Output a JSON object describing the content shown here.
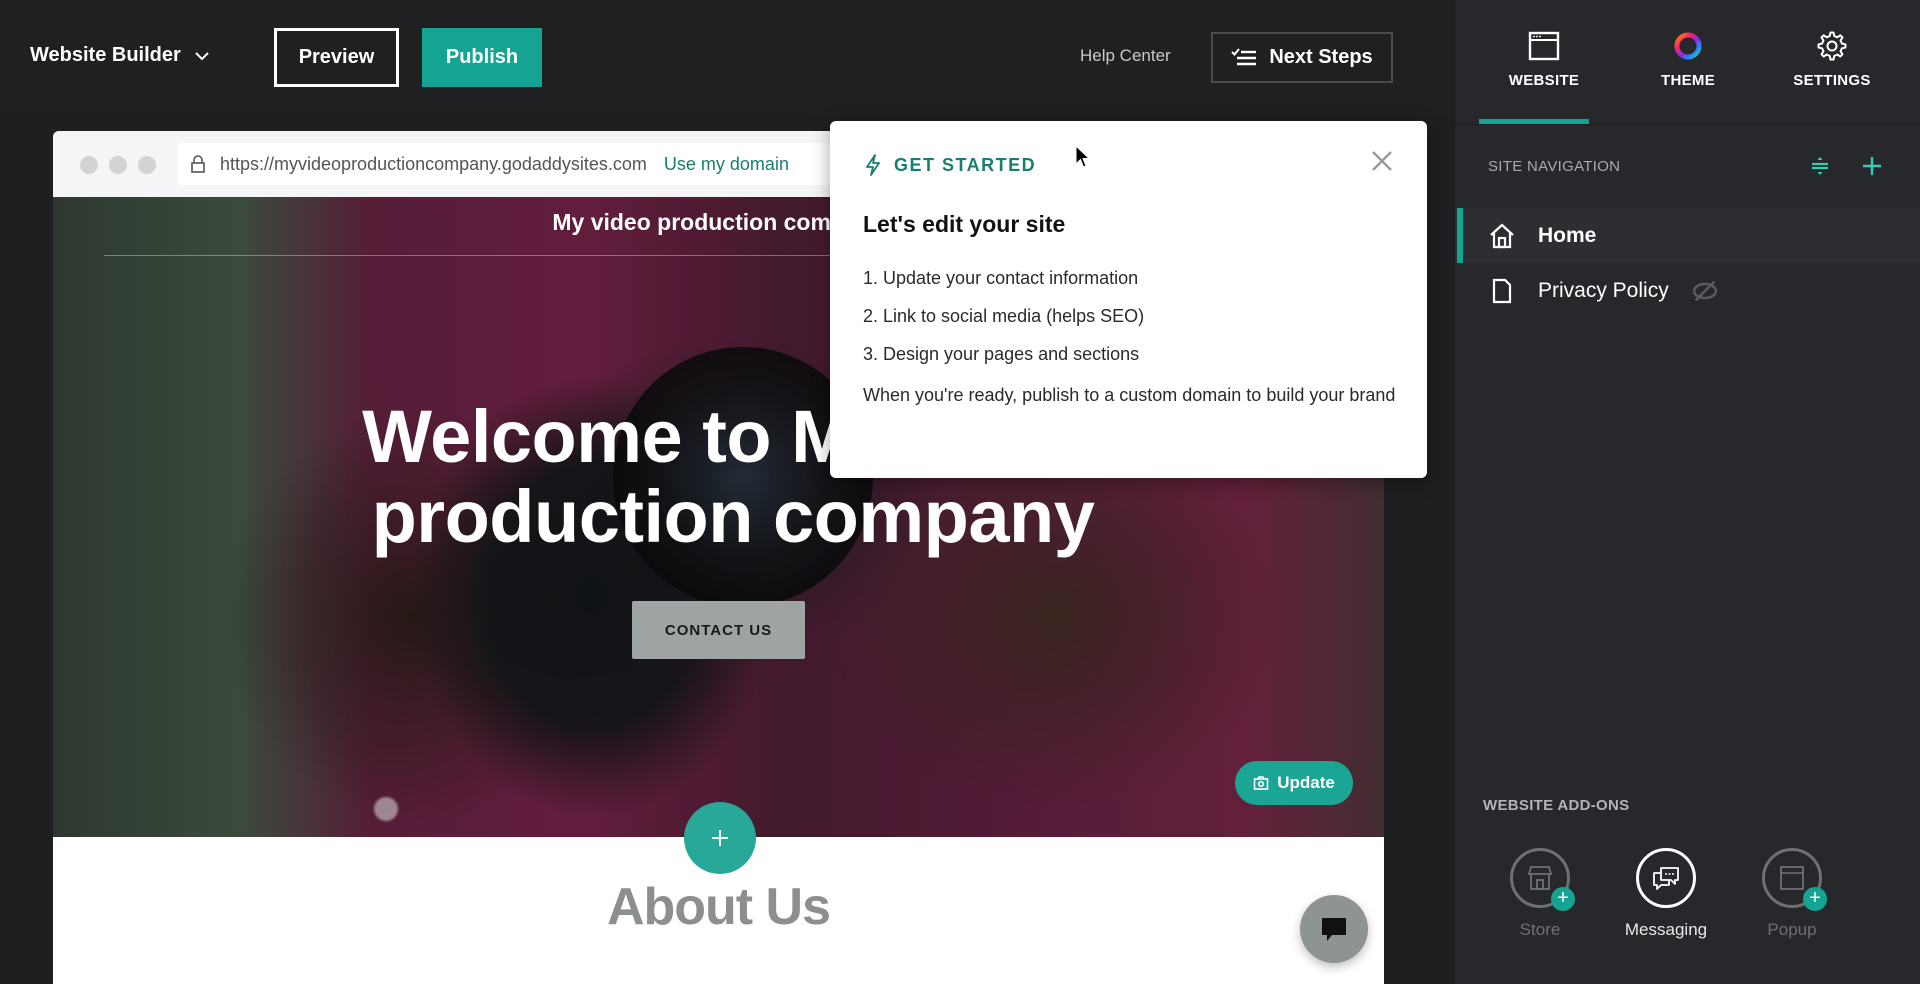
{
  "topbar": {
    "brand_label": "Website Builder",
    "preview_label": "Preview",
    "publish_label": "Publish",
    "help_label": "Help Center",
    "next_steps_label": "Next Steps"
  },
  "right_panel": {
    "tabs": [
      {
        "label": "WEBSITE",
        "icon": "browser-window-icon",
        "active": true
      },
      {
        "label": "THEME",
        "icon": "color-wheel-icon",
        "active": false
      },
      {
        "label": "SETTINGS",
        "icon": "gear-icon",
        "active": false
      }
    ],
    "site_navigation": {
      "heading": "SITE NAVIGATION",
      "items": [
        {
          "label": "Home",
          "icon": "home-icon",
          "active": true
        },
        {
          "label": "Privacy Policy",
          "icon": "page-icon",
          "active": false,
          "hidden": true
        }
      ]
    },
    "addons": {
      "heading": "WEBSITE ADD-ONS",
      "items": [
        {
          "label": "Store",
          "icon": "store-icon",
          "enabled": false
        },
        {
          "label": "Messaging",
          "icon": "messaging-icon",
          "enabled": true
        },
        {
          "label": "Popup",
          "icon": "popup-icon",
          "enabled": false
        }
      ]
    }
  },
  "browser": {
    "url": "https://myvideoproductioncompany.godaddysites.com",
    "domain_link": "Use my domain"
  },
  "site": {
    "title": "My video production company",
    "hero_heading": "Welcome to My video production company",
    "contact_button": "CONTACT US",
    "update_button": "Update",
    "about_title": "About Us"
  },
  "popover": {
    "kicker": "GET STARTED",
    "title": "Let's edit your site",
    "steps": [
      "1. Update your contact information",
      "2. Link to social media (helps SEO)",
      "3. Design your pages and sections"
    ],
    "footer": "When you're ready, publish to a custom domain to build your brand"
  },
  "colors": {
    "accent": "#15a493",
    "toolbar_bg": "#1f2022",
    "panel_bg": "#27282b",
    "kicker_text": "#1a7d70"
  }
}
